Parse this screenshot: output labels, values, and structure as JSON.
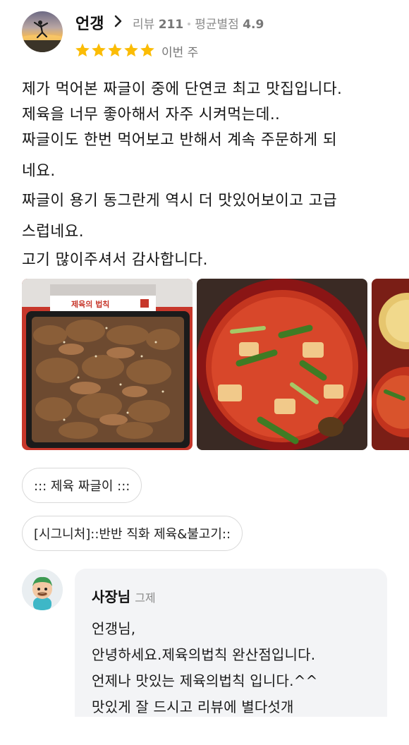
{
  "review": {
    "nickname": "언갱",
    "review_label": "리뷰",
    "review_count": "211",
    "avg_label": "평균별점",
    "avg_score": "4.9",
    "rating": 5,
    "when": "이번 주",
    "lines": [
      "제가 먹어본 짜글이 중에 단연코 최고 맛집입니다.",
      "제육을 너무 좋아해서 자주 시켜먹는데..",
      "짜글이도 한번 먹어보고 반해서 계속 주문하게 되",
      "네요.",
      "짜글이 용기 동그란게 역시 더 맛있어보이고 고급",
      "스럽네요.",
      "고기 많이주셔서 감사합니다."
    ],
    "photo_sign_text": "제육의 법칙",
    "tags": [
      "::: 제육 짜글이 :::",
      "[시그니처]::반반 직화 제육&불고기::"
    ]
  },
  "owner_reply": {
    "name": "사장님",
    "when": "그제",
    "lines": [
      "언갱님,",
      "안녕하세요.제육의법칙 완산점입니다.",
      "언제나 맛있는 제육의법칙 입니다.^^",
      "맛있게 잘 드시고 리뷰에 별다섯개"
    ]
  },
  "colors": {
    "star": "#FBBC05",
    "muted_text": "#8B8B8B",
    "reply_bg": "#F3F4F6",
    "tag_border": "#D9D9D9"
  }
}
